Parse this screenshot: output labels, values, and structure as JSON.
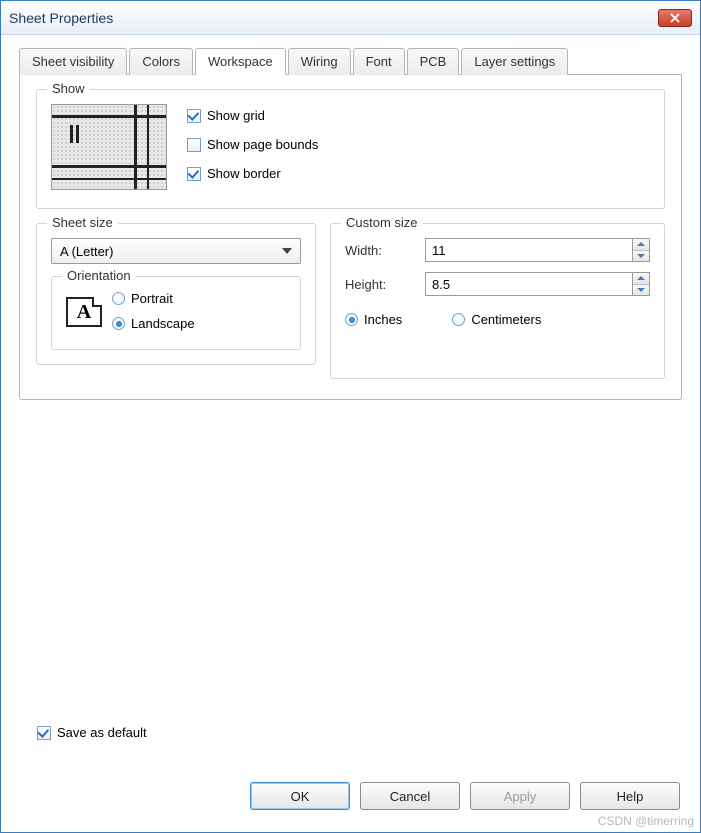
{
  "title": "Sheet Properties",
  "tabs": [
    "Sheet visibility",
    "Colors",
    "Workspace",
    "Wiring",
    "Font",
    "PCB",
    "Layer settings"
  ],
  "active_tab": 2,
  "show": {
    "legend": "Show",
    "grid_label": "Show grid",
    "grid_checked": true,
    "bounds_label": "Show page bounds",
    "bounds_checked": false,
    "border_label": "Show border",
    "border_checked": true
  },
  "sheet_size": {
    "legend": "Sheet size",
    "dropdown_value": "A (Letter)",
    "orientation": {
      "legend": "Orientation",
      "icon_letter": "A",
      "portrait_label": "Portrait",
      "landscape_label": "Landscape",
      "selected": "landscape"
    }
  },
  "custom_size": {
    "legend": "Custom size",
    "width_label": "Width:",
    "width_value": "11",
    "height_label": "Height:",
    "height_value": "8.5",
    "inches_label": "Inches",
    "centimeters_label": "Centimeters",
    "unit_selected": "inches"
  },
  "save_default": {
    "label": "Save as default",
    "checked": true
  },
  "buttons": {
    "ok": "OK",
    "cancel": "Cancel",
    "apply": "Apply",
    "help": "Help"
  },
  "watermark": "CSDN @timerring"
}
